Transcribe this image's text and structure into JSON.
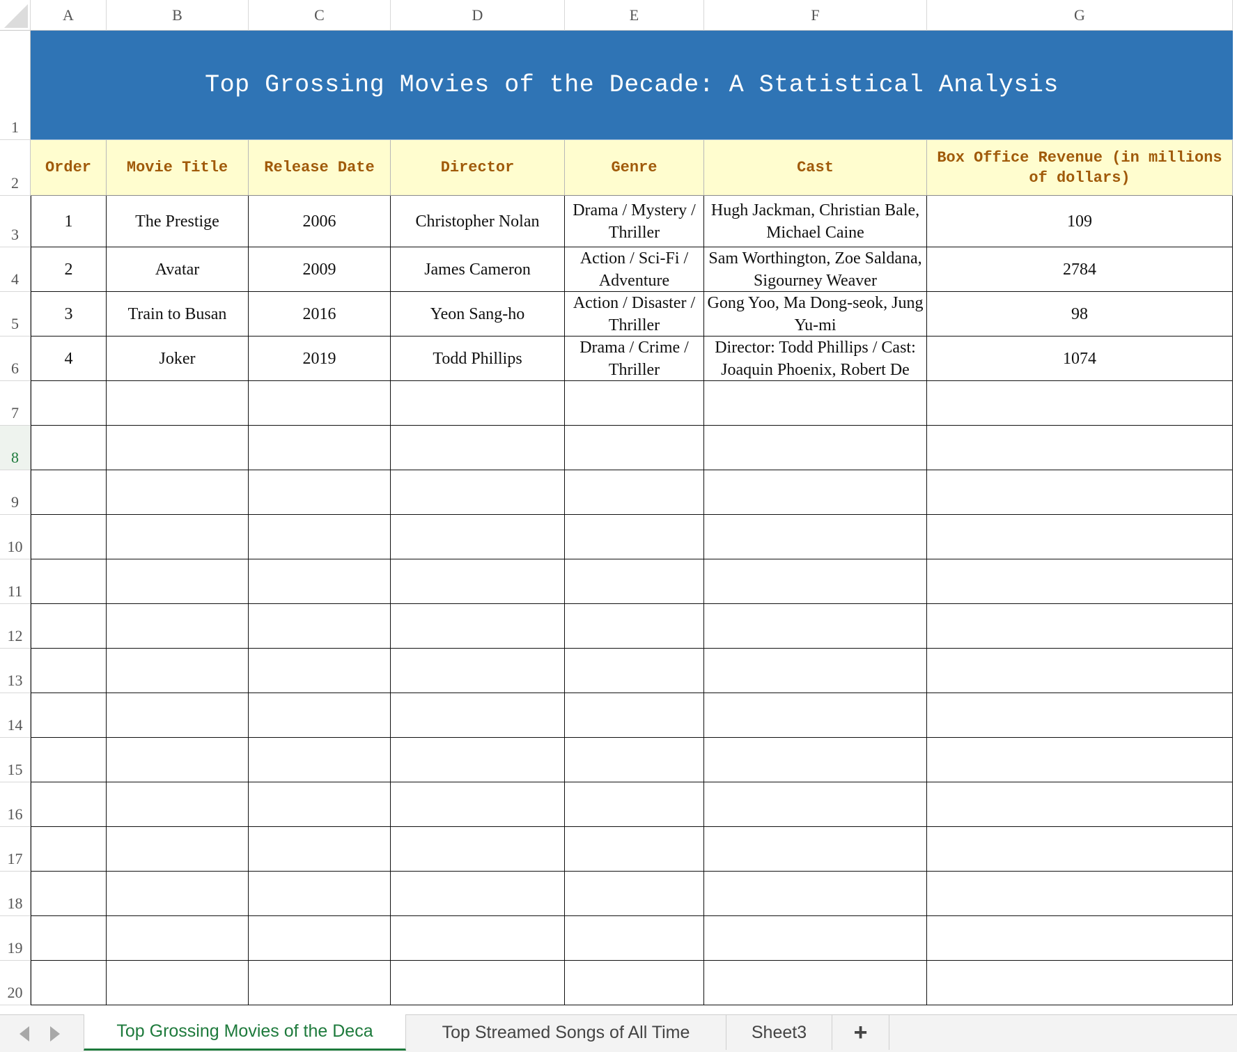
{
  "sheet": {
    "column_headers": [
      "A",
      "B",
      "C",
      "D",
      "E",
      "F",
      "G"
    ],
    "row_headers": [
      "1",
      "2",
      "3",
      "4",
      "5",
      "6",
      "7",
      "8",
      "9",
      "10",
      "11",
      "12",
      "13",
      "14",
      "15",
      "16",
      "17",
      "18",
      "19",
      "20"
    ],
    "active_row": "8",
    "title": "Top Grossing Movies of the Decade: A Statistical Analysis",
    "table_headers": [
      "Order",
      "Movie Title",
      "Release Date",
      "Director",
      "Genre",
      "Cast",
      "Box Office Revenue (in millions of dollars)"
    ],
    "rows": [
      [
        "1",
        "The Prestige",
        "2006",
        "Christopher Nolan",
        "Drama / Mystery / Thriller",
        "Hugh Jackman, Christian Bale, Michael Caine",
        "109"
      ],
      [
        "2",
        "Avatar",
        "2009",
        "James Cameron",
        "Action / Sci-Fi / Adventure",
        "Sam Worthington, Zoe Saldana, Sigourney Weaver",
        "2784"
      ],
      [
        "3",
        "Train to Busan",
        "2016",
        "Yeon Sang-ho",
        "Action / Disaster / Thriller",
        "Gong Yoo, Ma Dong-seok, Jung Yu-mi",
        "98"
      ],
      [
        "4",
        "Joker",
        "2019",
        "Todd Phillips",
        "Drama / Crime / Thriller",
        "Director: Todd Phillips / Cast: Joaquin Phoenix, Robert De",
        "1074"
      ]
    ]
  },
  "colors": {
    "title_background": "#2f74b5",
    "header_background": "#fffdcf",
    "header_text": "#a05a0a",
    "active_tab": "#1e7a3c"
  },
  "tabs": {
    "items": [
      "Top Grossing Movies of the Deca",
      "Top Streamed Songs of All Time",
      "Sheet3"
    ],
    "active_index": 0,
    "add_label": "+"
  },
  "icons": {
    "prev": "chevron-left-icon",
    "next": "chevron-right-icon",
    "corner": "select-all-icon"
  }
}
